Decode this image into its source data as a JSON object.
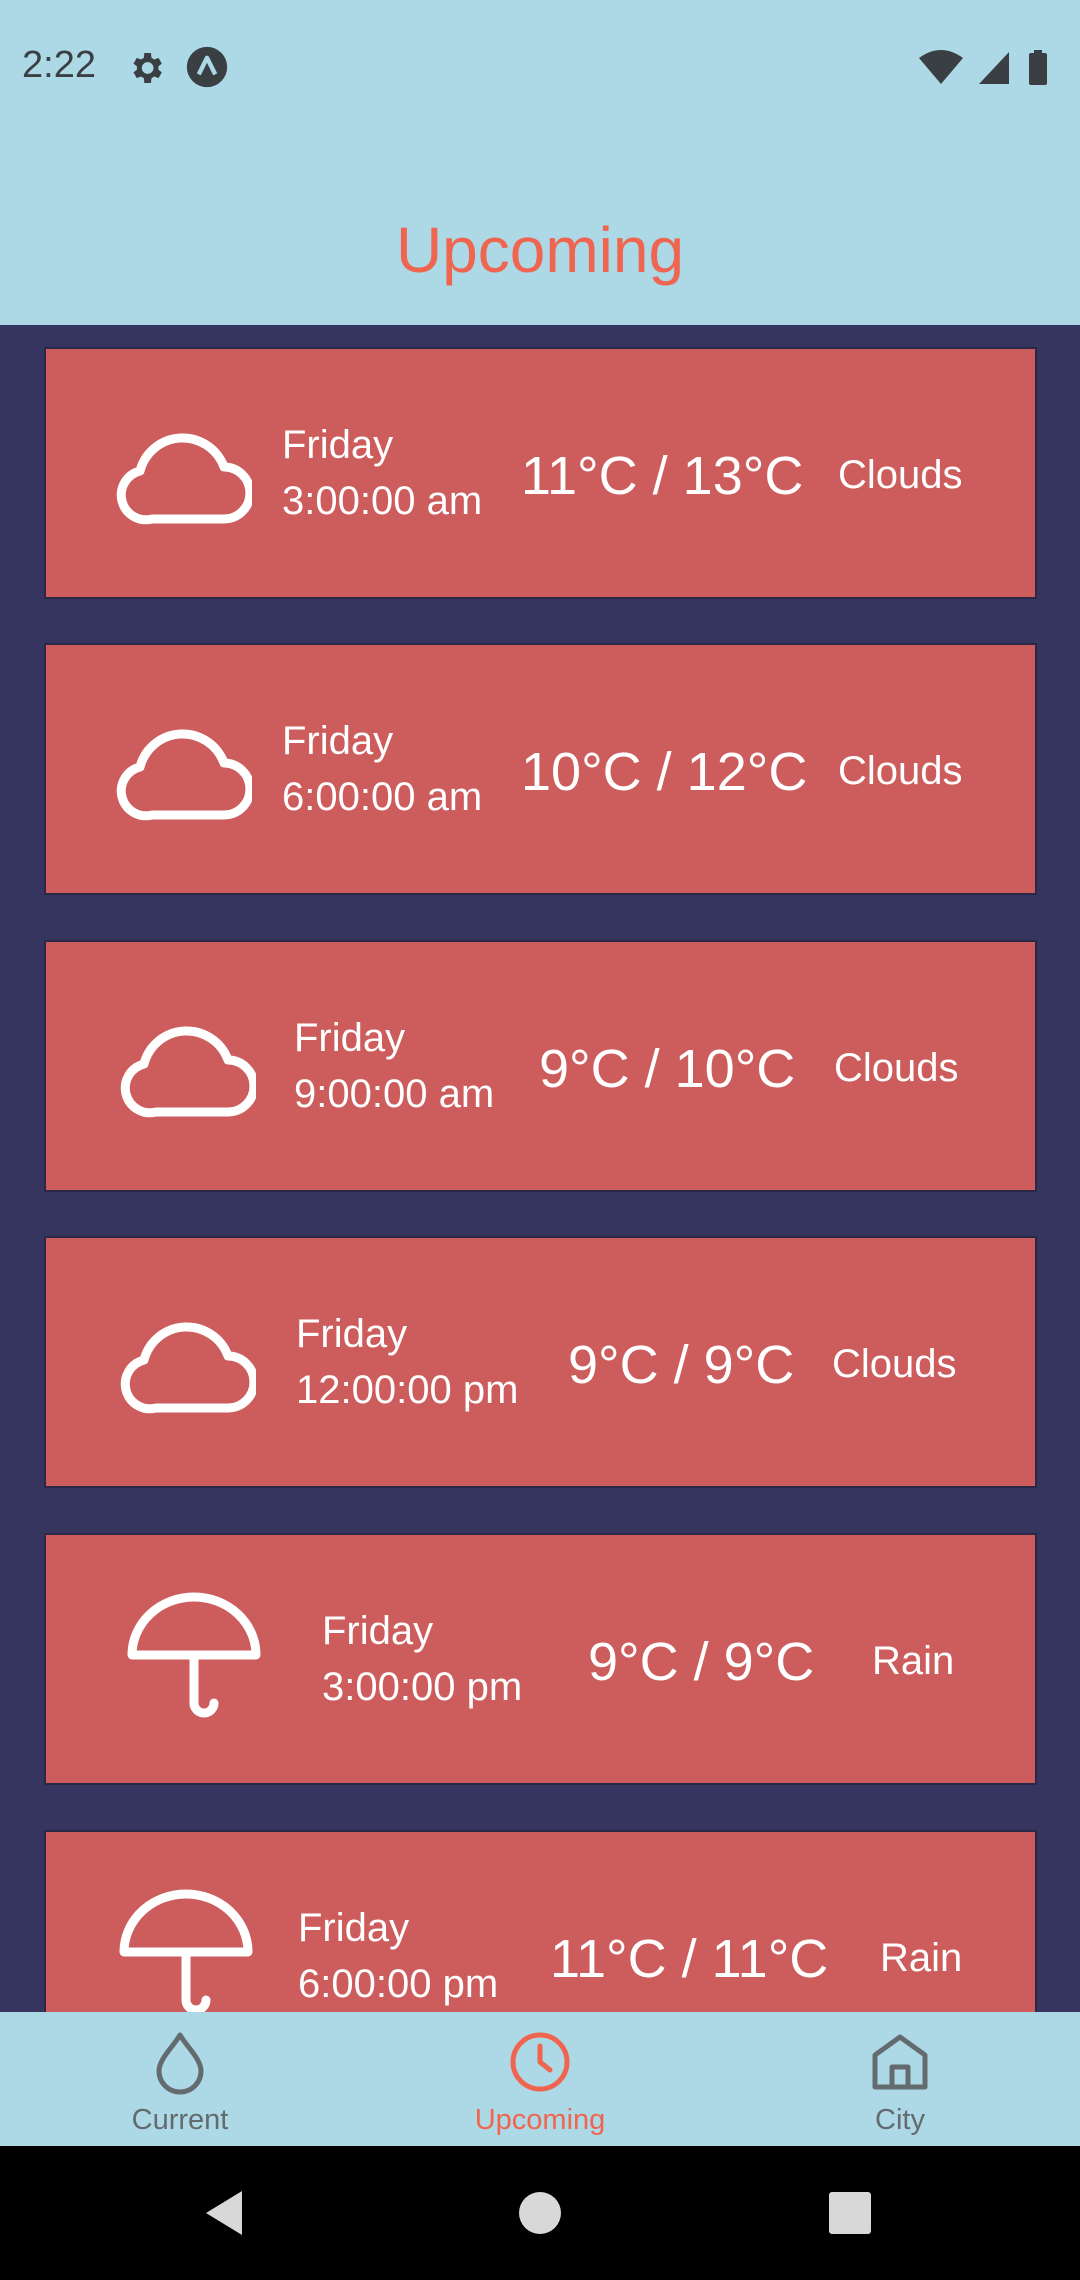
{
  "status_bar": {
    "time": "2:22",
    "icons": [
      "gear-icon",
      "app-badge-icon",
      "wifi-icon",
      "cellular-signal-icon",
      "battery-icon"
    ]
  },
  "header": {
    "title": "Upcoming"
  },
  "forecast": [
    {
      "icon": "cloud-icon",
      "day": "Friday",
      "time": "3:00:00 am",
      "temp": "11°C / 13°C",
      "condition": "Clouds"
    },
    {
      "icon": "cloud-icon",
      "day": "Friday",
      "time": "6:00:00 am",
      "temp": "10°C / 12°C",
      "condition": "Clouds"
    },
    {
      "icon": "cloud-icon",
      "day": "Friday",
      "time": "9:00:00 am",
      "temp": "9°C / 10°C",
      "condition": "Clouds"
    },
    {
      "icon": "cloud-icon",
      "day": "Friday",
      "time": "12:00:00 pm",
      "temp": "9°C / 9°C",
      "condition": "Clouds"
    },
    {
      "icon": "umbrella-icon",
      "day": "Friday",
      "time": "3:00:00 pm",
      "temp": "9°C / 9°C",
      "condition": "Rain"
    },
    {
      "icon": "umbrella-icon",
      "day": "Friday",
      "time": "6:00:00 pm",
      "temp": "11°C / 11°C",
      "condition": "Rain"
    }
  ],
  "bottom_nav": {
    "items": [
      {
        "label": "Current",
        "icon": "droplet-icon",
        "active": false
      },
      {
        "label": "Upcoming",
        "icon": "clock-icon",
        "active": true
      },
      {
        "label": "City",
        "icon": "home-icon",
        "active": false
      }
    ]
  },
  "system_nav": [
    "back-icon",
    "home-circle-icon",
    "recents-icon"
  ],
  "colors": {
    "background_top": "#ADD8E6",
    "accent": "#F0654F",
    "content_bg": "#363560",
    "card_bg": "#CD5C5C",
    "nav_inactive": "#646B6E"
  }
}
